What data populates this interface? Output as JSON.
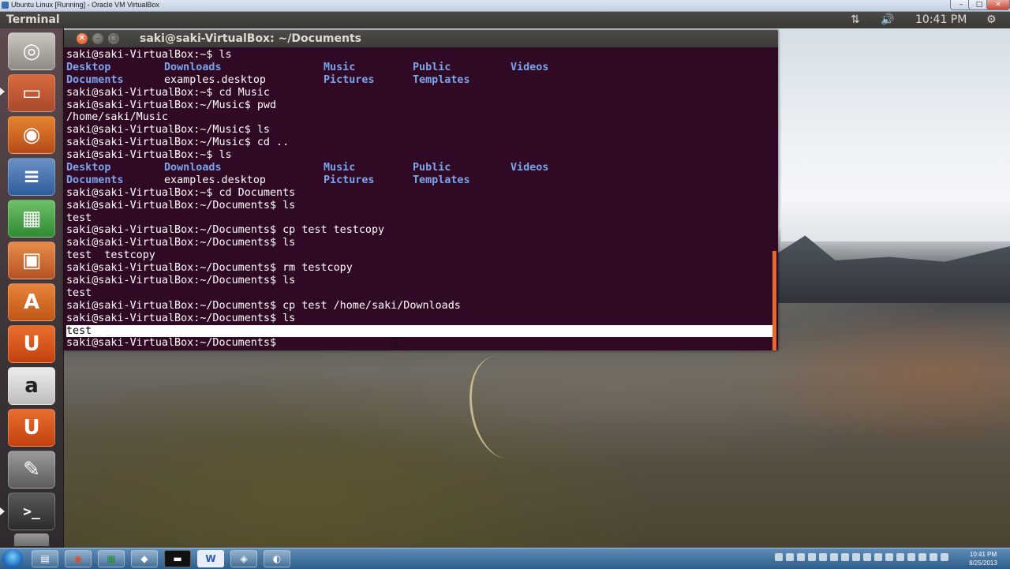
{
  "host": {
    "window_title": "Ubuntu Linux [Running] - Oracle VM VirtualBox",
    "min_glyph": "–",
    "max_glyph": "□",
    "close_glyph": "✕",
    "clock_time": "10:41 PM",
    "clock_date": "8/25/2013",
    "taskbar_items": [
      "windows-explorer",
      "google-chrome",
      "excel",
      "app",
      "command-prompt",
      "word",
      "virtualbox",
      "app"
    ]
  },
  "top_panel": {
    "app_name": "Terminal",
    "network_glyph": "⇅",
    "volume_glyph": "🔊",
    "clock": "10:41 PM",
    "gear_glyph": "⚙"
  },
  "launcher": {
    "items": [
      {
        "name": "dash-home",
        "glyph": "◎"
      },
      {
        "name": "files",
        "glyph": "▭"
      },
      {
        "name": "firefox",
        "glyph": "◉"
      },
      {
        "name": "libreoffice-writer",
        "glyph": "≡"
      },
      {
        "name": "libreoffice-calc",
        "glyph": "▦"
      },
      {
        "name": "libreoffice-impress",
        "glyph": "▣"
      },
      {
        "name": "ubuntu-software-center",
        "glyph": "A"
      },
      {
        "name": "ubuntu-one",
        "glyph": "U"
      },
      {
        "name": "amazon",
        "glyph": "a"
      },
      {
        "name": "ubuntu-one-music",
        "glyph": "U"
      },
      {
        "name": "system-settings",
        "glyph": "✎"
      },
      {
        "name": "terminal",
        "glyph": ">_"
      }
    ]
  },
  "terminal": {
    "title": "saki@saki-VirtualBox: ~/Documents",
    "close_glyph": "✕",
    "min_glyph": "–",
    "max_glyph": "□",
    "lines": {
      "l1": "saki@saki-VirtualBox:~$ ls",
      "l2": [
        "Desktop",
        "Downloads",
        "Music",
        "Public",
        "Videos"
      ],
      "l3": [
        "Documents",
        "examples.desktop",
        "Pictures",
        "Templates"
      ],
      "l4": "saki@saki-VirtualBox:~$ cd Music",
      "l5": "saki@saki-VirtualBox:~/Music$ pwd",
      "l6": "/home/saki/Music",
      "l7": "saki@saki-VirtualBox:~/Music$ ls",
      "l8": "saki@saki-VirtualBox:~/Music$ cd ..",
      "l9": "saki@saki-VirtualBox:~$ ls",
      "l10": [
        "Desktop",
        "Downloads",
        "Music",
        "Public",
        "Videos"
      ],
      "l11": [
        "Documents",
        "examples.desktop",
        "Pictures",
        "Templates"
      ],
      "l12": "saki@saki-VirtualBox:~$ cd Documents",
      "l13": "saki@saki-VirtualBox:~/Documents$ ls",
      "l14": "test",
      "l15": "saki@saki-VirtualBox:~/Documents$ cp test testcopy",
      "l16": "saki@saki-VirtualBox:~/Documents$ ls",
      "l17": "test  testcopy",
      "l18": "saki@saki-VirtualBox:~/Documents$ rm testcopy",
      "l19": "saki@saki-VirtualBox:~/Documents$ ls",
      "l20": "test",
      "l21": "saki@saki-VirtualBox:~/Documents$ cp test /home/saki/Downloads",
      "l22": "saki@saki-VirtualBox:~/Documents$ ls",
      "l23": "test",
      "l24": "saki@saki-VirtualBox:~/Documents$ "
    },
    "colors": {
      "background": "#300a24",
      "text": "#ffffff",
      "directory": "#7aa5ec",
      "scrollbar": "#e8692a"
    }
  }
}
